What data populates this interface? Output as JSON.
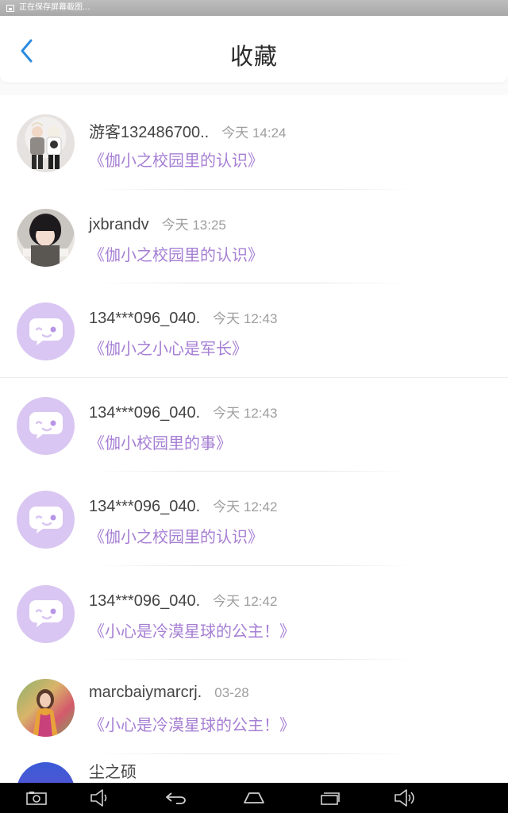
{
  "status_bar": {
    "text": "正在保存屏幕截图..."
  },
  "header": {
    "title": "收藏"
  },
  "favorites": [
    {
      "username": "游客132486700..",
      "time": "今天 14:24",
      "title": "《伽小之校园里的认识》",
      "avatar": "photo-two-people"
    },
    {
      "username": "jxbrandv",
      "time": "今天 13:25",
      "title": "《伽小之校园里的认识》",
      "avatar": "photo-girl"
    },
    {
      "username": "134***096_040.",
      "time": "今天 12:43",
      "title": "《伽小之小心是军长》",
      "avatar": "default-chat-icon"
    },
    {
      "username": "134***096_040.",
      "time": "今天 12:43",
      "title": "《伽小校园里的事》",
      "avatar": "default-chat-icon"
    },
    {
      "username": "134***096_040.",
      "time": "今天 12:42",
      "title": "《伽小之校园里的认识》",
      "avatar": "default-chat-icon"
    },
    {
      "username": "134***096_040.",
      "time": "今天 12:42",
      "title": "《小心是冷漠星球的公主！》",
      "avatar": "default-chat-icon"
    },
    {
      "username": "marcbaiymarcrj.",
      "time": "03-28",
      "title": "《小心是冷漠星球的公主！》",
      "avatar": "photo-woman"
    }
  ],
  "partial_item": {
    "username": "尘之硕"
  },
  "nav_bar": {
    "buttons": [
      "screenshot-icon",
      "volume-down-icon",
      "back-icon",
      "home-icon",
      "recents-icon",
      "volume-up-icon"
    ]
  },
  "colors": {
    "accent_blue": "#2d8be0",
    "title_purple": "#a67fd4",
    "avatar_lilac": "#d9c6f2"
  }
}
